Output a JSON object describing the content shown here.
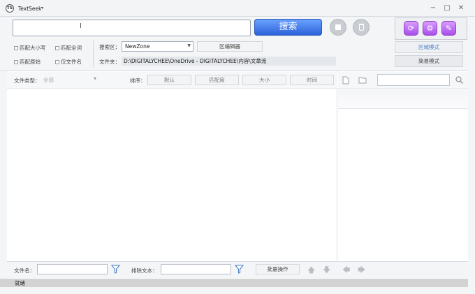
{
  "titlebar": {
    "logo_text": "TS",
    "title": "TextSeek",
    "menu_caret": "▾",
    "minimize": "−",
    "maximize": "□",
    "close": "✕"
  },
  "search": {
    "value": "",
    "button_label": "搜索"
  },
  "options": {
    "match_case": "匹配大小写",
    "match_whole": "匹配全词",
    "match_original": "匹配原始",
    "filename_only": "仅文件名"
  },
  "zone": {
    "label": "搜索区：",
    "selected": "NewZone",
    "editor_button": "区编辑器",
    "folder_label": "文件夹：",
    "folder_path": "D:\\DIGITALYCHEE\\OneDrive - DIGITALYCHEE\\内容\\文章流"
  },
  "modes": {
    "zone_mode": "区域模式",
    "simple_mode": "简易模式"
  },
  "filter": {
    "file_type_label": "文件类型：",
    "file_type_value": "全部",
    "sort_label": "排序：",
    "sort_default": "默认",
    "sort_match": "匹配度",
    "sort_size": "大小",
    "sort_time": "时间"
  },
  "bottom": {
    "filename_label": "文件名：",
    "exclude_label": "排除文本：",
    "batch_button": "批量操作"
  },
  "status": {
    "text": "就绪"
  },
  "colors": {
    "accent_blue": "#2c62d8",
    "tool_purple": "#a84ee8",
    "mode_text": "#4a7fc8"
  }
}
